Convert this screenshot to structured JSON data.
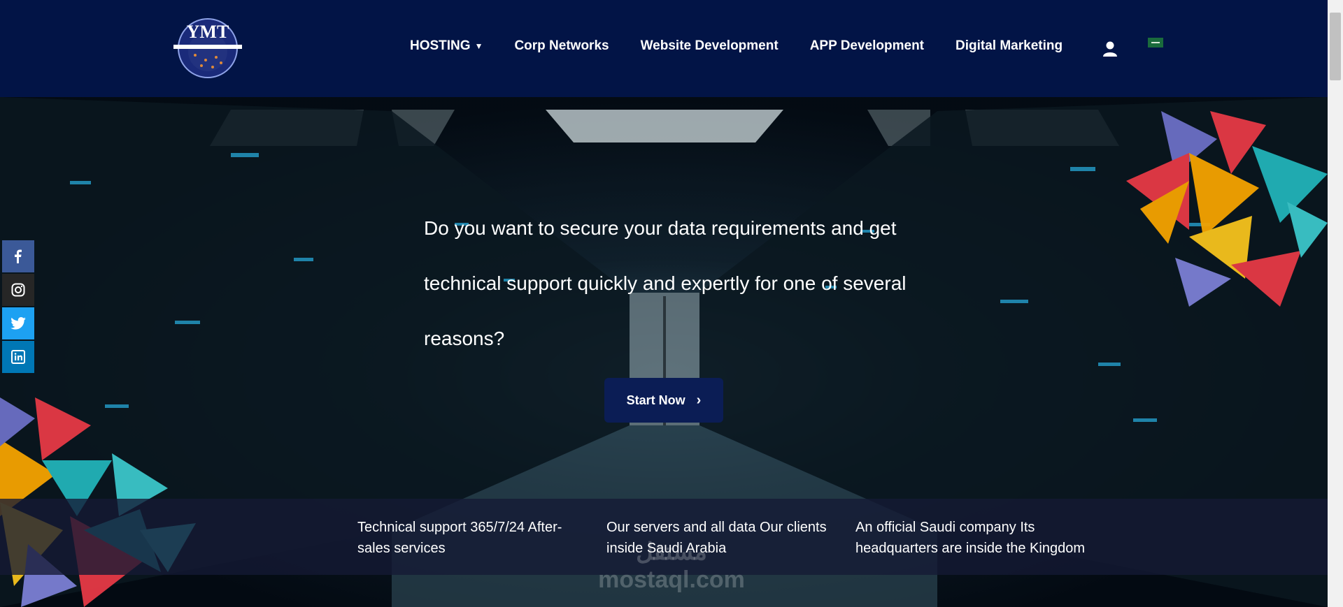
{
  "header": {
    "logo_text": "YMT",
    "nav": [
      {
        "label": "HOSTING"
      },
      {
        "label": "Corp Networks"
      },
      {
        "label": "Website Development"
      },
      {
        "label": "APP Development"
      },
      {
        "label": "Digital Marketing"
      }
    ]
  },
  "hero": {
    "headline": "Do you want to secure your data requirements and get technical support quickly and expertly for one of several reasons?",
    "cta_label": "Start Now",
    "features": [
      {
        "text": "Technical support 365/7/24 After-sales services"
      },
      {
        "text": "Our servers and all data Our clients inside Saudi Arabia"
      },
      {
        "text": "An official Saudi company Its headquarters are inside the Kingdom"
      }
    ]
  },
  "social": [
    "facebook",
    "instagram",
    "twitter",
    "linkedin"
  ],
  "watermark": {
    "line1": "مستقل",
    "line2": "mostaql.com"
  },
  "colors": {
    "header_bg": "#021446",
    "cta_bg": "#0b1d55",
    "facebook": "#3b5998",
    "twitter": "#1da1f2",
    "linkedin": "#0077b5"
  }
}
